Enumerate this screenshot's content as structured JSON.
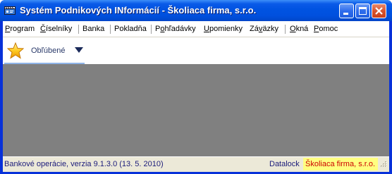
{
  "window": {
    "title": "Systém Podnikových INformácií - Školiaca firma, s.r.o.",
    "colors": {
      "titlebar": "#0053e1",
      "workspace": "#808080",
      "company_badge_bg": "#ffff80",
      "company_badge_text": "#cc0000"
    }
  },
  "menu": {
    "items": [
      {
        "label": "Program",
        "key": "P"
      },
      {
        "label": "Číselníky",
        "key": "Č"
      },
      {
        "label": "Banka",
        "key": ""
      },
      {
        "label": "Pokladňa",
        "key": ""
      },
      {
        "label": "Pohľadávky",
        "key": "o"
      },
      {
        "label": "Upomienky",
        "key": "U"
      },
      {
        "label": "Záväzky",
        "key": "v"
      },
      {
        "label": "Okná",
        "key": "O"
      },
      {
        "label": "Pomoc",
        "key": "P"
      }
    ]
  },
  "toolbar": {
    "favorites_label": "Obľúbené",
    "favorites_icon": "star-icon",
    "dropdown_icon": "triangle-down-icon"
  },
  "status": {
    "module_version": "Bankové operácie, verzia 9.1.3.0 (13. 5. 2010)",
    "datalock": "Datalock",
    "company": "Školiaca firma, s.r.o."
  }
}
